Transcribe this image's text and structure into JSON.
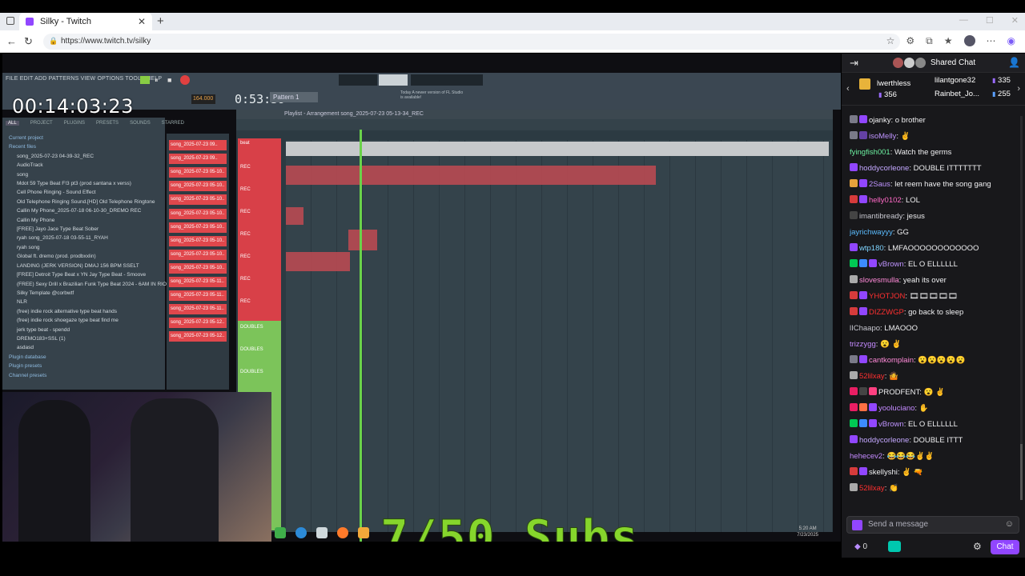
{
  "browser": {
    "tab_title": "Silky - Twitch",
    "url": "https://www.twitch.tv/silky"
  },
  "stream": {
    "timer": "00:14:03:23",
    "song_time": "0:53:39",
    "tempo": "164.000",
    "pattern": "Pattern 1",
    "fl_menu": "FILE  EDIT  ADD  PATTERNS  VIEW  OPTIONS  TOOLS  HELP",
    "fl_hint": "Today  A newer version of FL Studio is available!",
    "playlist_title": "Playlist - Arrangement    song_2025-07-23 05-13-34_REC",
    "browser_tabs": [
      "ALL",
      "PROJECT",
      "PLUGINS",
      "PRESETS",
      "SOUNDS",
      "STARRED"
    ],
    "browser_items": [
      {
        "t": "Current project",
        "h": true
      },
      {
        "t": "Recent files",
        "h": true
      },
      {
        "t": "song_2025-07-23 04-39-32_REC"
      },
      {
        "t": "AudioTrack"
      },
      {
        "t": "song"
      },
      {
        "t": "Mdot 59 Type Beat F!3 pt3 (prod santana x verss)"
      },
      {
        "t": "Cell Phone Ringing - Sound Effect"
      },
      {
        "t": "Old Telephone Ringing Sound.[HD]  Old Telephone Ringtone"
      },
      {
        "t": "Callin My Phone_2025-07-18 06-10-30_DREMO REC"
      },
      {
        "t": "Callin My Phone"
      },
      {
        "t": "[FREE] Jayo  Jace Type Beat Sober"
      },
      {
        "t": "ryah song_2025-07-18 03-55-11_RYAH"
      },
      {
        "t": "ryah song"
      },
      {
        "t": "Global ft. dremo (prod. prodbxxlin)"
      },
      {
        "t": "LANDING (JERK VERSION) DMAJ 156 BPM SSELT"
      },
      {
        "t": "[FREE] Detroit Type Beat x YN Jay Type Beat - Smoove"
      },
      {
        "t": "(FREE) Sexy Drill x Brazilian Funk Type Beat 2024 - 6AM IN RIO"
      },
      {
        "t": "Silky Template @corbwtf"
      },
      {
        "t": "NLR"
      },
      {
        "t": "(free) indie rock  alternative type beat hands"
      },
      {
        "t": "(free) indie rock  shoegaze type beat find me"
      },
      {
        "t": "jerk type beat - spendd"
      },
      {
        "t": "DREMO183+SSL (1)"
      },
      {
        "t": "asdasd"
      },
      {
        "t": "Plugin database",
        "h": true
      },
      {
        "t": "Plugin presets",
        "h": true
      },
      {
        "t": "Channel presets",
        "h": true
      }
    ],
    "channels": [
      "song_2025-07-23 09..",
      "song_2025-07-23 09..",
      "song_2025-07-23 05-10..",
      "song_2025-07-23 05-10..",
      "song_2025-07-23 05-10..",
      "song_2025-07-23 05-10..",
      "song_2025-07-23 05-10..",
      "song_2025-07-23 05-10..",
      "song_2025-07-23 05-10..",
      "song_2025-07-23 05-10..",
      "song_2025-07-23 05-11..",
      "song_2025-07-23 05-11..",
      "song_2025-07-23 05-11..",
      "song_2025-07-23 05-12..",
      "song_2025-07-23 05-12.."
    ],
    "track_labels": [
      "beat",
      "REC",
      "REC",
      "REC",
      "REC",
      "REC",
      "REC",
      "REC",
      "DOUBLES",
      "DOUBLES",
      "DOUBLES"
    ],
    "subs_overlay": "7/50 Subs",
    "clock_time": "5:20 AM",
    "clock_date": "7/23/2025"
  },
  "chat": {
    "title": "Shared Chat",
    "leaderboard": [
      {
        "name": "lwerthless",
        "score": "356"
      },
      {
        "name": "lilantgone32",
        "score": "335"
      },
      {
        "name": "Rainbet_Jo...",
        "score": "255"
      }
    ],
    "messages": [
      {
        "user": "ojanky",
        "color": "#efeff1",
        "text": ": o brother",
        "badges": [
          "#7a7a88",
          "#9146ff"
        ]
      },
      {
        "user": "isoMelly",
        "color": "#bf94ff",
        "text": ": ✌",
        "badges": [
          "#7a7a88",
          "#6441a5"
        ]
      },
      {
        "user": "fyingfish001",
        "color": "#6cf0a0",
        "text": ": Watch the germs",
        "badges": []
      },
      {
        "user": "hoddycorleone",
        "color": "#c4a8ff",
        "text": ": DOUBLE ITTTTTTT",
        "badges": [
          "#9146ff"
        ]
      },
      {
        "user": "2Saus",
        "color": "#bf94ff",
        "text": ": let reem have the song gang",
        "badges": [
          "#e6a23c",
          "#9146ff"
        ]
      },
      {
        "user": "helly0102",
        "color": "#ff69c6",
        "text": ": LOL",
        "badges": [
          "#d63b3b",
          "#9146ff"
        ]
      },
      {
        "user": "imantibready",
        "color": "#c8c8d0",
        "text": ": jesus",
        "badges": [
          "#444"
        ]
      },
      {
        "user": "jayrichwayyy",
        "color": "#5bbcff",
        "text": ": GG",
        "badges": []
      },
      {
        "user": "wtp180",
        "color": "#7fd4ff",
        "text": ": LMFAOOOOOOOOOOOO",
        "badges": [
          "#9146ff"
        ]
      },
      {
        "user": "vBrown",
        "color": "#bf94ff",
        "text": ": EL O ELLLLLL",
        "badges": [
          "#00c853",
          "#3c8cff",
          "#9146ff"
        ]
      },
      {
        "user": "slovesmulla",
        "color": "#ff8ad8",
        "text": ": yeah its over",
        "badges": [
          "#aaa"
        ]
      },
      {
        "user": "YHOTJON",
        "color": "#ff3030",
        "text": ": 🎞🎞🎞🎞🎞",
        "badges": [
          "#d63b3b",
          "#9146ff"
        ]
      },
      {
        "user": "DIZZWGP",
        "color": "#ff3030",
        "text": ": go back to sleep",
        "badges": [
          "#d63b3b",
          "#9146ff"
        ]
      },
      {
        "user": "lIChaapo",
        "color": "#c8c8d0",
        "text": ": LMAOOO",
        "badges": []
      },
      {
        "user": "trizzygg",
        "color": "#c48aff",
        "text": ": 😮 ✌",
        "badges": []
      },
      {
        "user": "cantkomplain",
        "color": "#ff8ad8",
        "text": ": 😮😮😮😮😮",
        "badges": [
          "#7a7a88",
          "#9146ff"
        ]
      },
      {
        "user": "52lilxay",
        "color": "#ff3030",
        "text": ": 🤷",
        "badges": [
          "#aaa"
        ]
      },
      {
        "user": "PRODFENT",
        "color": "#efeff1",
        "text": ": 😮 ✌",
        "badges": [
          "#e91e63",
          "#444",
          "#ff4081"
        ]
      },
      {
        "user": "yooluciano",
        "color": "#c48aff",
        "text": ": ✋",
        "badges": [
          "#e91e63",
          "#ff7043",
          "#9146ff"
        ]
      },
      {
        "user": "vBrown",
        "color": "#bf94ff",
        "text": ": EL O ELLLLLL",
        "badges": [
          "#00c853",
          "#3c8cff",
          "#9146ff"
        ]
      },
      {
        "user": "hoddycorleone",
        "color": "#c4a8ff",
        "text": ": DOUBLE ITTT",
        "badges": [
          "#9146ff"
        ]
      },
      {
        "user": "hehecev2",
        "color": "#c48aff",
        "text": ": 😂😂😂✌✌",
        "badges": []
      },
      {
        "user": "skellyshi",
        "color": "#efeff1",
        "text": ": ✌ 🔫",
        "badges": [
          "#d63b3b",
          "#9146ff"
        ]
      },
      {
        "user": "52lilxay",
        "color": "#ff3030",
        "text": ": 👏",
        "badges": [
          "#aaa"
        ]
      }
    ],
    "input_placeholder": "Send a message",
    "points": "0",
    "chat_button": "Chat"
  }
}
